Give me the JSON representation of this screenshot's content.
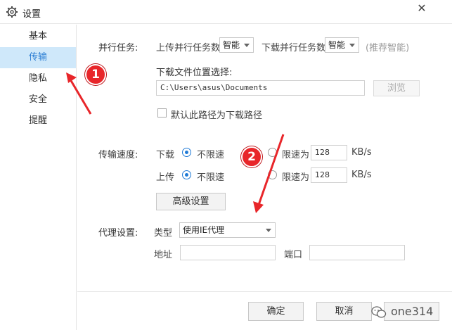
{
  "window": {
    "title": "设置",
    "close_glyph": "✕",
    "icon": "gear-icon"
  },
  "sidebar": {
    "items": [
      {
        "label": "基本",
        "active": false
      },
      {
        "label": "传输",
        "active": true
      },
      {
        "label": "隐私",
        "active": false
      },
      {
        "label": "安全",
        "active": false
      },
      {
        "label": "提醒",
        "active": false
      }
    ]
  },
  "parallel": {
    "section_label": "并行任务:",
    "upload_label": "上传并行任务数",
    "upload_value": "智能",
    "download_label": "下载并行任务数",
    "download_value": "智能",
    "hint": "(推荐智能)"
  },
  "download_location": {
    "label": "下载文件位置选择:",
    "path": "C:\\Users\\asus\\Documents",
    "browse_label": "浏览",
    "default_checkbox_label": "默认此路径为下载路径"
  },
  "speed": {
    "section_label": "传输速度:",
    "download_label": "下载",
    "upload_label": "上传",
    "unlimited_label": "不限速",
    "limit_label": "限速为",
    "download_limit_value": "128",
    "upload_limit_value": "128",
    "unit": "KB/s",
    "advanced_button": "高级设置"
  },
  "proxy": {
    "section_label": "代理设置:",
    "type_label": "类型",
    "type_value": "使用IE代理",
    "address_label": "地址",
    "port_label": "端口"
  },
  "footer": {
    "ok_label": "确定",
    "cancel_label": "取消"
  },
  "annotations": {
    "marker1": "1",
    "marker2": "2",
    "color": "#e8262a"
  },
  "watermark": {
    "text": "one314"
  }
}
